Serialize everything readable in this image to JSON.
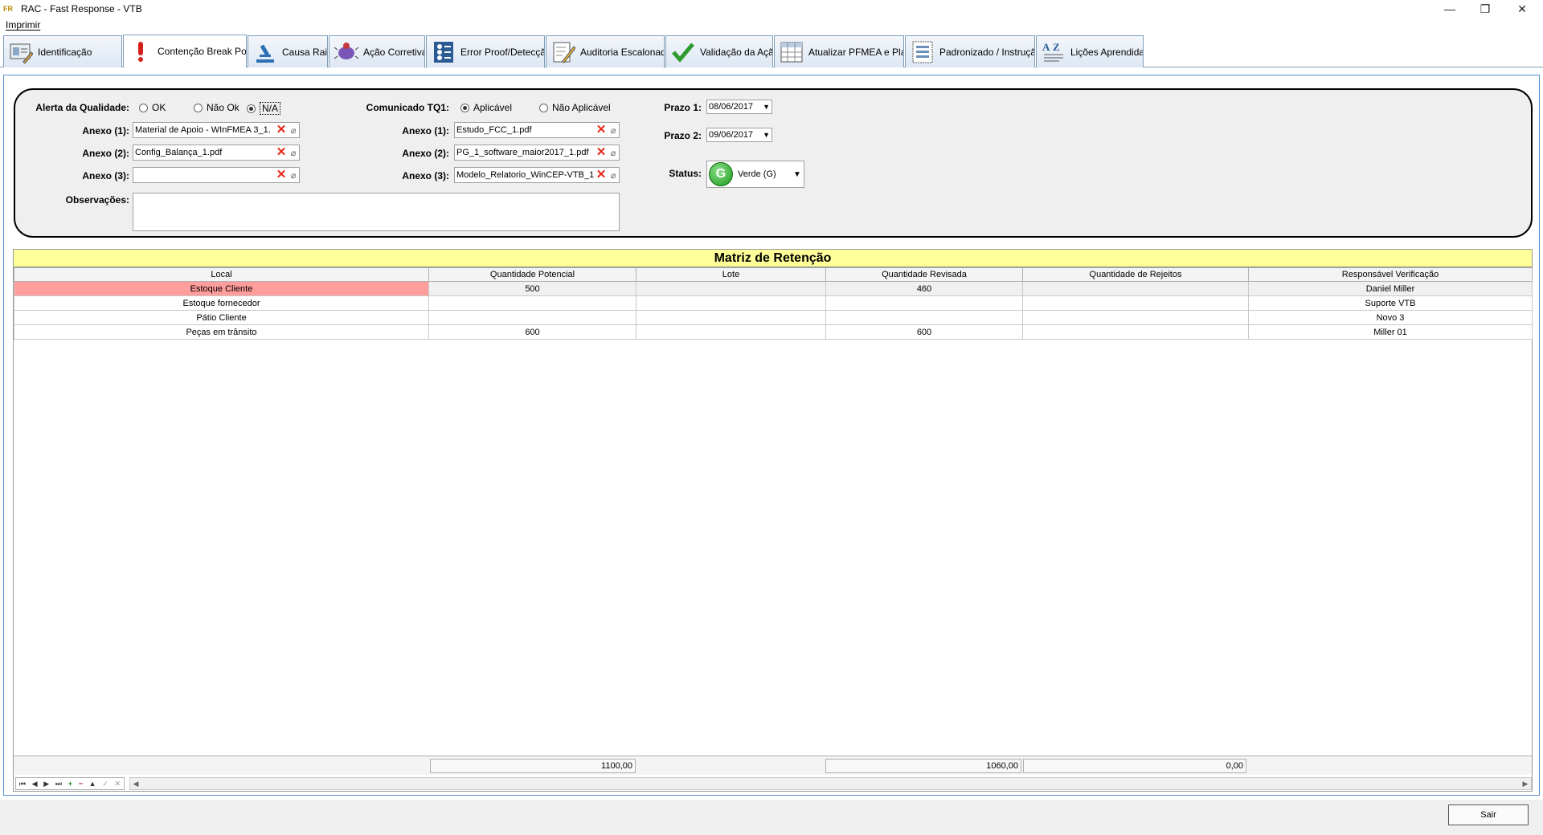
{
  "window": {
    "app_icon_text": "FR",
    "title": "RAC - Fast Response - VTB",
    "minimize_glyph": "—",
    "restore_glyph": "❐",
    "close_glyph": "✕"
  },
  "menu": {
    "imprimir": "Imprimir"
  },
  "tabs": [
    {
      "label": "Identificação",
      "icon": "id-card-icon"
    },
    {
      "label": "Contenção Break Point",
      "icon": "exclamation-icon"
    },
    {
      "label": "Causa Raiz",
      "icon": "microscope-icon"
    },
    {
      "label": "Ação Corretiva",
      "icon": "bug-icon"
    },
    {
      "label": "Error Proof/Detecção",
      "icon": "checklist-icon"
    },
    {
      "label": "Auditoria Escalonada",
      "icon": "pencil-doc-icon"
    },
    {
      "label": "Validação da Ação",
      "icon": "checkmark-icon"
    },
    {
      "label": "Atualizar PFMEA e Plano",
      "icon": "spreadsheet-icon"
    },
    {
      "label": "Padronizado / Instrução",
      "icon": "list-doc-icon"
    },
    {
      "label": "Lições Aprendidas",
      "icon": "az-sort-icon"
    }
  ],
  "form": {
    "alerta_label": "Alerta da Qualidade:",
    "alerta_options": [
      "OK",
      "Não Ok",
      "N/A"
    ],
    "alerta_selected": "N/A",
    "left_anexos": [
      {
        "label": "Anexo (1):",
        "value": "Material de Apoio - WInFMEA 3_1."
      },
      {
        "label": "Anexo (2):",
        "value": "Config_Balança_1.pdf"
      },
      {
        "label": "Anexo (3):",
        "value": ""
      }
    ],
    "obs_label": "Observações:",
    "obs_value": "",
    "comunicado_label": "Comunicado TQ1:",
    "comunicado_options": [
      "Aplicável",
      "Não Aplicável"
    ],
    "comunicado_selected": "Aplicável",
    "right_anexos": [
      {
        "label": "Anexo (1):",
        "value": "Estudo_FCC_1.pdf"
      },
      {
        "label": "Anexo (2):",
        "value": "PG_1_software_maior2017_1.pdf"
      },
      {
        "label": "Anexo (3):",
        "value": "Modelo_Relatorio_WinCEP-VTB_1."
      }
    ],
    "prazo1_label": "Prazo 1:",
    "prazo1_value": "08/06/2017",
    "prazo2_label": "Prazo 2:",
    "prazo2_value": "09/06/2017",
    "status_label": "Status:",
    "status_badge": "G",
    "status_value": "Verde (G)",
    "status_color": "#1a9a1a",
    "clear_glyph": "✕",
    "attach_glyph": "⌀",
    "dropdown_glyph": "▼"
  },
  "matrix": {
    "title": "Matriz de Retenção",
    "title_bg": "#ffff99",
    "headers": [
      "Local",
      "Quantidade Potencial",
      "Lote",
      "Quantidade Revisada",
      "Quantidade de Rejeitos",
      "Responsável Verificação"
    ],
    "rows": [
      [
        "Estoque Cliente",
        "500",
        "",
        "460",
        "",
        "Daniel Miller"
      ],
      [
        "Estoque fornecedor",
        "",
        "",
        "",
        "",
        "Suporte VTB"
      ],
      [
        "Pátio Cliente",
        "",
        "",
        "",
        "",
        "Novo 3"
      ],
      [
        "Peças em trânsito",
        "600",
        "",
        "600",
        "",
        "Miller 01"
      ]
    ],
    "highlight_color": "#ff9c9c",
    "totals": {
      "potencial": "1100,00",
      "revisada": "1060,00",
      "rejeitos": "0,00"
    },
    "nav_glyphs": [
      "⏮",
      "◀",
      "▶",
      "⏭",
      "+",
      "−",
      "▲",
      "✓",
      "✕"
    ],
    "scroll_glyphs": [
      "◀",
      "▶"
    ]
  },
  "footer": {
    "sair": "Sair"
  }
}
